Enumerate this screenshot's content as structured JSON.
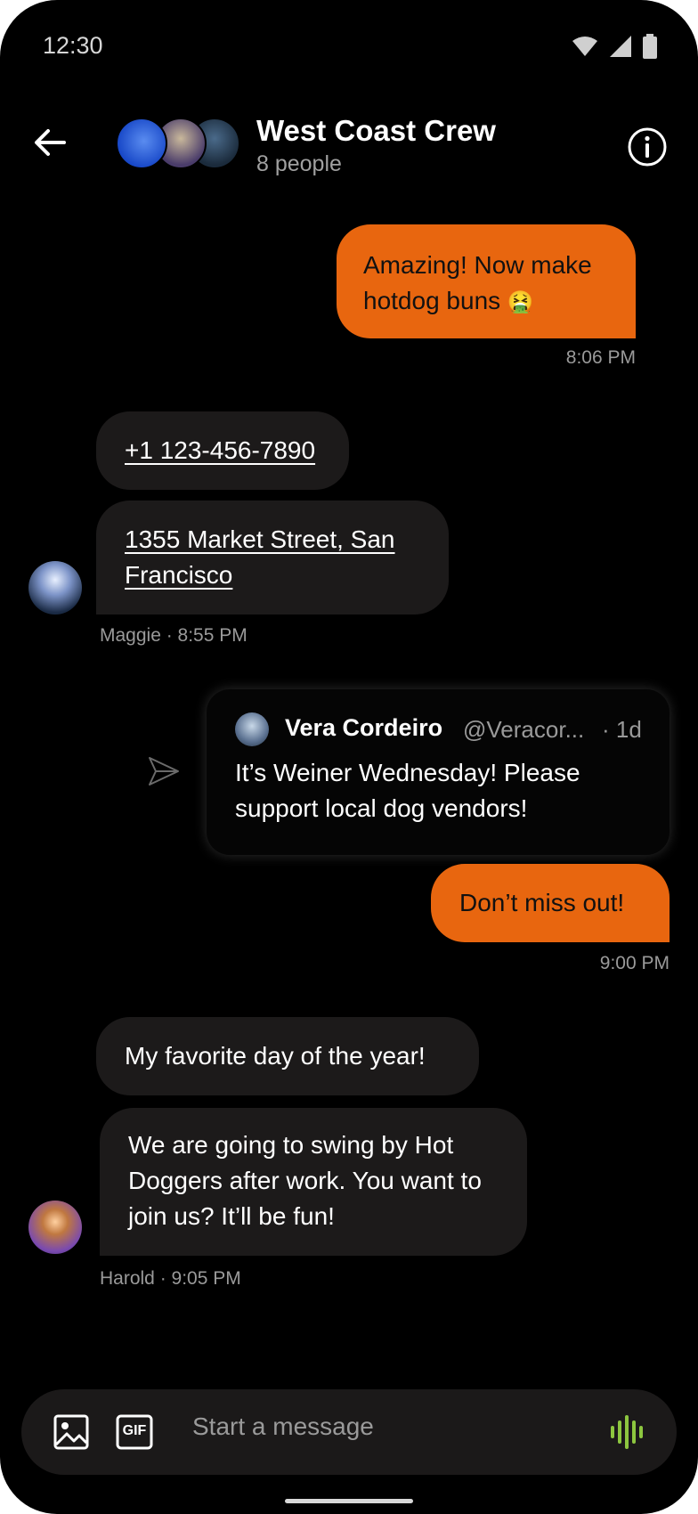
{
  "status_bar": {
    "time": "12:30"
  },
  "header": {
    "title": "West Coast Crew",
    "subtitle": "8 people"
  },
  "messages": {
    "m1": {
      "text": "Amazing! Now make hotdog buns",
      "emoji": "🤮",
      "time": "8:06 PM"
    },
    "m2": {
      "phone": "+1 123-456-7890"
    },
    "m3": {
      "line1": "1355 Market Street, San",
      "line2": "Francisco",
      "meta": "Maggie · 8:55 PM"
    },
    "tweet": {
      "author": "Vera Cordeiro",
      "handle": "@Veracor...",
      "age": "· 1d",
      "text": "It’s Weiner Wednesday! Please support local dog vendors!"
    },
    "m4": {
      "text": "Don’t miss out!",
      "time": "9:00 PM"
    },
    "m5": {
      "text": "My favorite day of the year!"
    },
    "m6": {
      "text": "We are going to swing by Hot Doggers after work. You want to join us? It’ll be fun!",
      "meta": "Harold · 9:05 PM"
    }
  },
  "composer": {
    "placeholder": "Start a message",
    "gif_label": "GIF"
  },
  "colors": {
    "outgoing_bubble": "#e8660f",
    "incoming_bubble": "#1c1a1a",
    "voice_icon": "#8dc63f"
  }
}
